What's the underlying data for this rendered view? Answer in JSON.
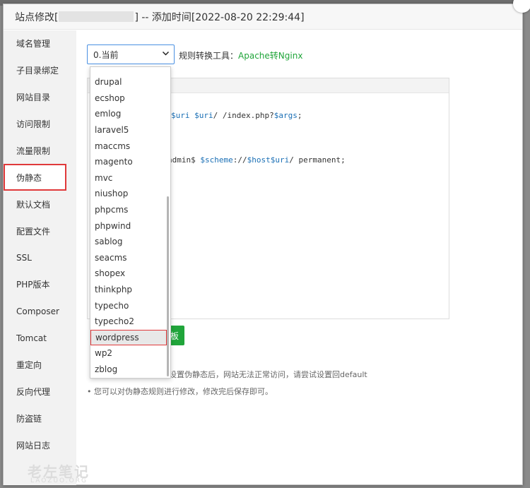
{
  "dialog": {
    "title_prefix": "站点修改[",
    "title_suffix": "] -- 添加时间[2022-08-20 22:29:44]"
  },
  "sidebar": {
    "items": [
      {
        "label": "域名管理"
      },
      {
        "label": "子目录绑定"
      },
      {
        "label": "网站目录"
      },
      {
        "label": "访问限制"
      },
      {
        "label": "流量限制"
      },
      {
        "label": "伪静态"
      },
      {
        "label": "默认文档"
      },
      {
        "label": "配置文件"
      },
      {
        "label": "SSL"
      },
      {
        "label": "PHP版本"
      },
      {
        "label": "Composer"
      },
      {
        "label": "Tomcat"
      },
      {
        "label": "重定向"
      },
      {
        "label": "反向代理"
      },
      {
        "label": "防盗链"
      },
      {
        "label": "网站日志"
      }
    ],
    "active_item": "伪静态"
  },
  "rewrite": {
    "selected": "0.当前",
    "tool_label": "规则转换工具：",
    "tool_link": "Apache转Nginx"
  },
  "editor": {
    "line1_a": "$uri",
    "line1_b": "$uri",
    "line1_c": "/ /index.php?",
    "line1_d": "$args",
    "line1_e": ";",
    "line2_a": "admin$",
    "line2_b": "$scheme",
    "line2_c": "://",
    "line2_d": "$host$uri",
    "line2_e": "/ permanent;"
  },
  "save_button_fragment": "板",
  "tips": {
    "line1": "设置伪静态后，网站无法正常访问，请尝试设置回default",
    "line2": "• 您可以对伪静态规则进行修改，修改完后保存即可。"
  },
  "dropdown": {
    "options": [
      "drupal",
      "ecshop",
      "emlog",
      "laravel5",
      "maccms",
      "magento",
      "mvc",
      "niushop",
      "phpcms",
      "phpwind",
      "sablog",
      "seacms",
      "shopex",
      "thinkphp",
      "typecho",
      "typecho2",
      "wordpress",
      "wp2",
      "zblog"
    ],
    "highlighted": "wordpress"
  },
  "watermark": {
    "text": "老左笔记",
    "sub": "LAOZUO.ORG"
  }
}
